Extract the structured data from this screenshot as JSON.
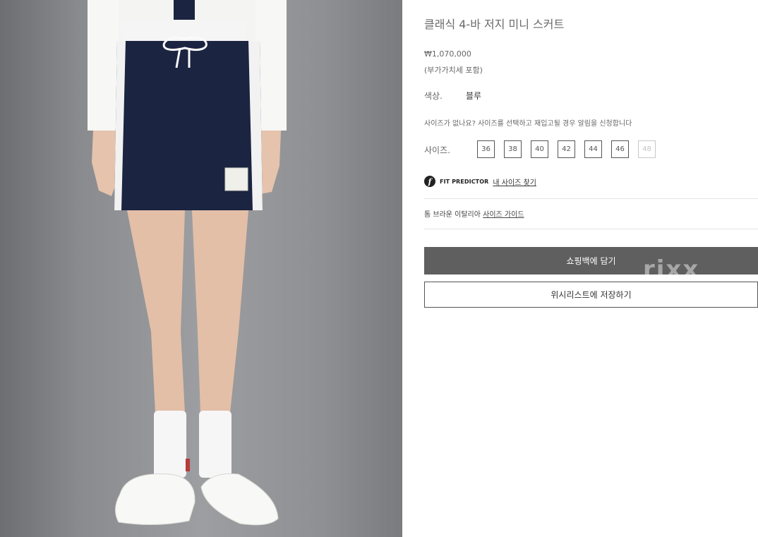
{
  "product": {
    "title": "클래식 4-바 저지 미니 스커트",
    "price": "₩1,070,000",
    "vat_note": "(부가가치세 포함)",
    "image_alt": "product-photo-skirt"
  },
  "color": {
    "label": "색상.",
    "value": "블루"
  },
  "size": {
    "notify_text": "사이즈가 없나요? 사이즈를 선택하고 재입고될 경우 알림을 신청합니다",
    "label": "사이즈.",
    "options": [
      {
        "label": "36",
        "available": true
      },
      {
        "label": "38",
        "available": true
      },
      {
        "label": "40",
        "available": true
      },
      {
        "label": "42",
        "available": true
      },
      {
        "label": "44",
        "available": true
      },
      {
        "label": "46",
        "available": true
      },
      {
        "label": "48",
        "available": false
      }
    ]
  },
  "fit_predictor": {
    "logo": "f",
    "brand": "FIT PREDICTOR",
    "link": "내 사이즈 찾기"
  },
  "size_guide": {
    "prefix": "톰 브라운 이탈리아",
    "link": "사이즈 가이드"
  },
  "actions": {
    "add_to_bag": "쇼핑백에 담기",
    "save_wishlist": "위시리스트에 저장하기"
  },
  "watermark": "rixx",
  "colors": {
    "bag_button": "#5f5f5f",
    "skirt_navy": "#1b2440"
  }
}
